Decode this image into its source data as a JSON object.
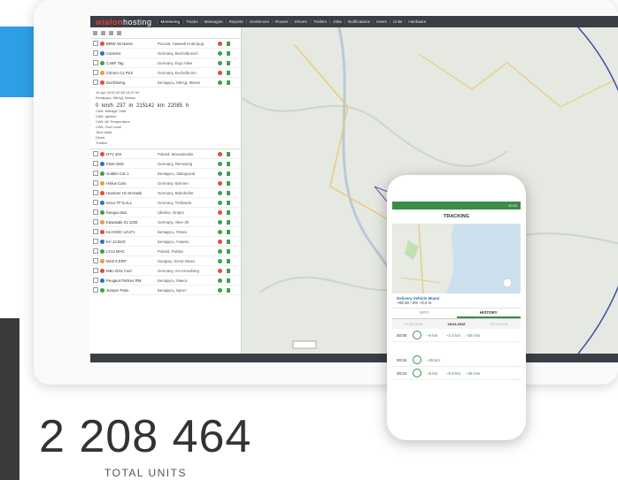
{
  "app": {
    "logo_part1": "wialon",
    "logo_part2": "hosting",
    "nav": [
      "Monitoring",
      "Tracks",
      "Messages",
      "Reports",
      "Geofences",
      "Routes",
      "Drivers",
      "Trailers",
      "Jobs",
      "Notifications",
      "Users",
      "Units",
      "Hardware"
    ]
  },
  "sidebar": {
    "units": [
      {
        "name": "BMW X6 Narva",
        "location": "Россия, Нижний Новгород"
      },
      {
        "name": "Camelot",
        "location": "Germany, Bechelbursch"
      },
      {
        "name": "CABF Tag",
        "location": "Germany, Ergo Allee"
      },
      {
        "name": "Citroen C1 Pick",
        "location": "Germany, Eschelbronn"
      },
      {
        "name": "DocDriving",
        "location": "Беларусь, МКАД, Минск"
      }
    ],
    "detail": {
      "time": "19 Apr 2016 02:38 14:37:00",
      "place": "Беларусь, МКАД, Минск",
      "stats": "0 km/h   237 m   215142 km   22085 h",
      "params": [
        "CAN: Mileage Total",
        "CAN: Ignition",
        "CAN: Air Temperature",
        "CAN: Fuel Level",
        "Time delta",
        "Driver",
        "Trailers"
      ]
    },
    "units2": [
      {
        "name": "DYV 404",
        "location": "Poland, Mazowieckie"
      },
      {
        "name": "Fleet Aktiv",
        "location": "Germany, Rennsteig"
      },
      {
        "name": "Golden Car 1",
        "location": "Беларусь, Заводской"
      },
      {
        "name": "Helios Cars",
        "location": "Germany, Bremen"
      },
      {
        "name": "Hummer H1 M-Hawk",
        "location": "Germany, Bahnhofstr"
      },
      {
        "name": "Iveco TF-5 ALL",
        "location": "Germany, Triebwerk"
      },
      {
        "name": "Kangoo Bus",
        "location": "Ukraine, Dnipro"
      },
      {
        "name": "Kawasaki Z1 1200",
        "location": "Germany, Allee 39"
      },
      {
        "name": "KLASSIC UA471",
        "location": "Беларусь, Пинск"
      },
      {
        "name": "KV 12 BUS",
        "location": "Беларусь, Гомель"
      },
      {
        "name": "LY14 MHC",
        "location": "Poland, Polska"
      },
      {
        "name": "MAZ 5 ERP",
        "location": "Hungary, Szent Istvan"
      },
      {
        "name": "MBJ 2011 Fuel",
        "location": "Germany, Am Kreuzberg"
      },
      {
        "name": "Peugeot Partner RW",
        "location": "Беларусь, Минск"
      },
      {
        "name": "Jumper Paris",
        "location": "Беларусь, Брест"
      }
    ]
  },
  "phone": {
    "status_time": "10:15",
    "title": "TRACKING",
    "vehicle_name": "Delivery Vehicle Miami",
    "vehicle_stats": "~09:16   ~3%   ~0.2 m",
    "tabs": [
      "INFO",
      "HISTORY"
    ],
    "dates": [
      "27.04.2016",
      "28.04.2016",
      "29.04.2016"
    ],
    "entries": [
      {
        "time": "00:00",
        "value": "~6 km",
        "dist": "~2.0 km",
        "dur": "~28 min"
      },
      {
        "time": "00:04",
        "value": "~38 km",
        "dist": "",
        "dur": ""
      },
      {
        "time": "00:04",
        "value": "~8 km",
        "dist": "~0.6 km",
        "dur": "~46 min"
      }
    ]
  },
  "stat": {
    "number": "2 208 464",
    "label": "TOTAL UNITS"
  }
}
